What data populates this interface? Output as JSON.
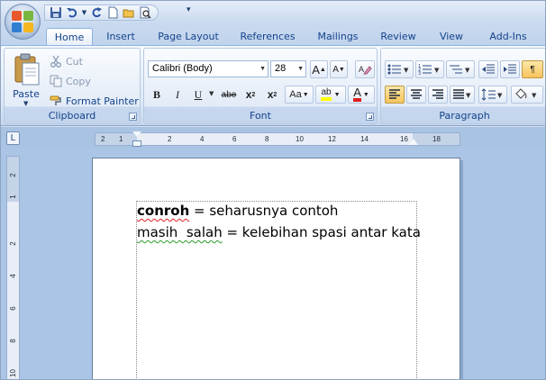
{
  "quick_access": {
    "icons": [
      "save-icon",
      "undo-icon",
      "redo-icon",
      "new-document-icon",
      "open-folder-icon",
      "print-preview-icon"
    ]
  },
  "tabs": [
    {
      "label": "Home",
      "active": true
    },
    {
      "label": "Insert",
      "active": false
    },
    {
      "label": "Page Layout",
      "active": false
    },
    {
      "label": "References",
      "active": false
    },
    {
      "label": "Mailings",
      "active": false
    },
    {
      "label": "Review",
      "active": false
    },
    {
      "label": "View",
      "active": false
    },
    {
      "label": "Add-Ins",
      "active": false
    }
  ],
  "clipboard": {
    "label": "Clipboard",
    "paste": "Paste",
    "cut": "Cut",
    "copy": "Copy",
    "format_painter": "Format Painter"
  },
  "font": {
    "label": "Font",
    "font_name": "Calibri (Body)",
    "font_size": "28",
    "grow": "A",
    "shrink": "A",
    "bold": "B",
    "italic": "I",
    "underline": "U",
    "strikethrough": "abe",
    "subscript": "x",
    "subscript_mark": "2",
    "superscript": "x",
    "superscript_mark": "2",
    "change_case": "Aa",
    "highlight": "ab",
    "font_color": "A"
  },
  "paragraph": {
    "label": "Paragraph",
    "show_hide": "¶"
  },
  "ruler": {
    "corner": "L",
    "numbers": [
      "2",
      "1",
      "2",
      "4",
      "6",
      "8",
      "10",
      "12",
      "14",
      "16",
      "18"
    ],
    "vertical_numbers": [
      "2",
      "1",
      "2",
      "4",
      "6",
      "8",
      "10"
    ]
  },
  "document": {
    "line1": {
      "word": "conroh",
      "rest": " = seharusnya contoh"
    },
    "line2": {
      "word": "masih  salah",
      "rest": " = kelebihan spasi antar kata"
    }
  },
  "colors": {
    "ribbon_text": "#15428b",
    "highlight_yellow": "#ffff00",
    "font_color_red": "#e02020",
    "spell_error": "#e02020",
    "grammar_error": "#2d9b2d"
  }
}
